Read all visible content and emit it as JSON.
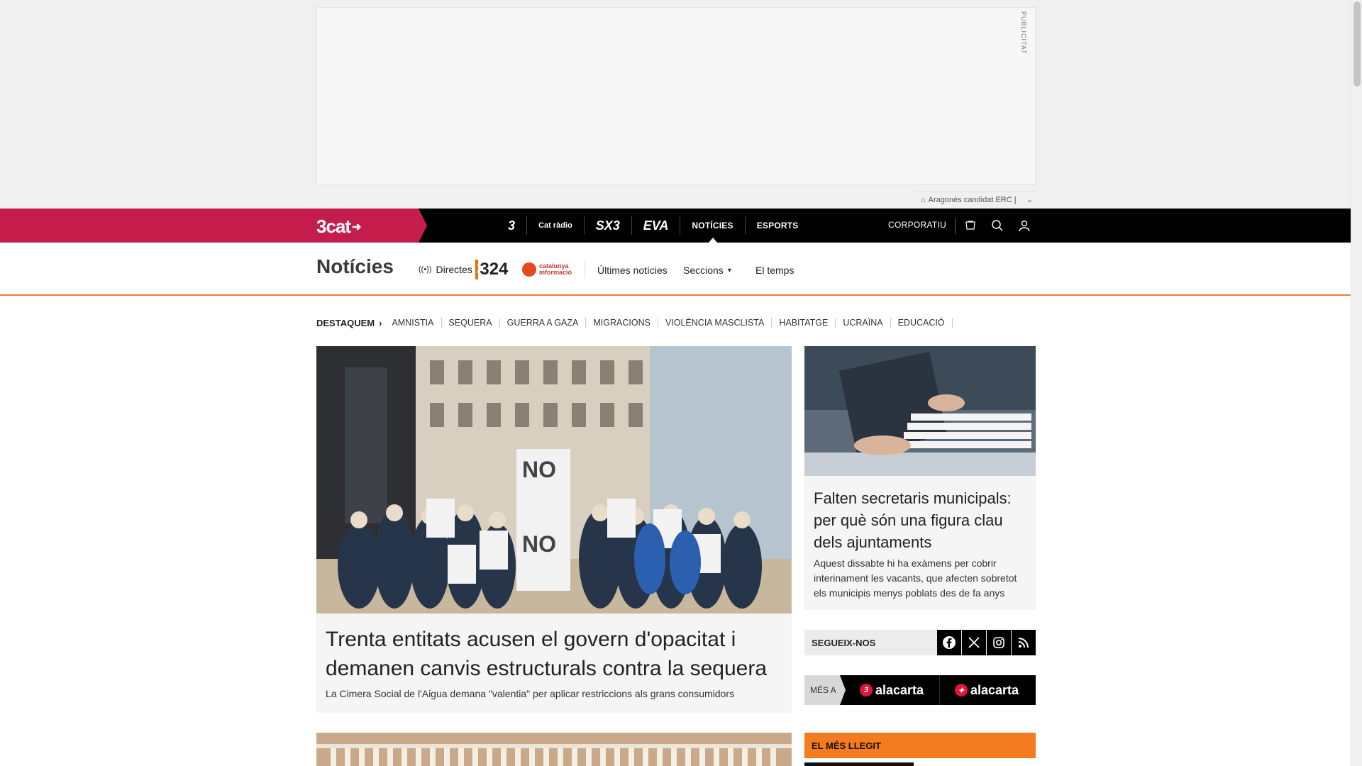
{
  "ad": {
    "label": "PUBLICITAT",
    "widget_text": "Aragonès candidat ERC |"
  },
  "topbar": {
    "brand": "3cat",
    "channels": [
      {
        "label": "3"
      },
      {
        "label": "Cat ràdio"
      },
      {
        "label": "SX3"
      },
      {
        "label": "EVA"
      },
      {
        "label": "NOTÍCIES"
      },
      {
        "label": "ESPORTS"
      }
    ],
    "corporate_label": "CORPORATIU"
  },
  "section": {
    "title": "Notícies",
    "live_label": "Directes",
    "logo_324": "324",
    "logo_ci": "catalunya informació",
    "links": [
      "Últimes notícies",
      "Seccions",
      "El temps"
    ]
  },
  "tags": {
    "lead": "DESTAQUEM",
    "items": [
      "AMNISTIA",
      "SEQUERA",
      "GUERRA A GAZA",
      "MIGRACIONS",
      "VIOLÈNCIA MASCLISTA",
      "HABITATGE",
      "UCRAÏNA",
      "EDUCACIÓ"
    ]
  },
  "main_article": {
    "title": "Trenta entitats acusen el govern d'opacitat i demanen canvis estructurals contra la sequera",
    "subtitle": "La Cimera Social de l'Aigua demana \"valentia\" per aplicar restriccions als grans consumidors"
  },
  "side_article": {
    "title": "Falten secretaris municipals: per què són una figura clau dels ajuntaments",
    "subtitle": "Aquest dissabte hi ha exàmens per cobrir interinament les vacants, que afecten sobretot els municipis menys poblats des de fa anys"
  },
  "follow": {
    "label": "SEGUEIX-NOS",
    "icons": [
      "facebook-icon",
      "x-icon",
      "instagram-icon",
      "rss-icon"
    ]
  },
  "mesa": {
    "label": "MÉS A",
    "items": [
      "alacarta",
      "alacarta"
    ]
  },
  "most_read": {
    "label": "EL MÉS LLEGIT"
  },
  "colors": {
    "brand": "#c51d4b",
    "accent": "#f47b20",
    "topbar": "#000000"
  }
}
